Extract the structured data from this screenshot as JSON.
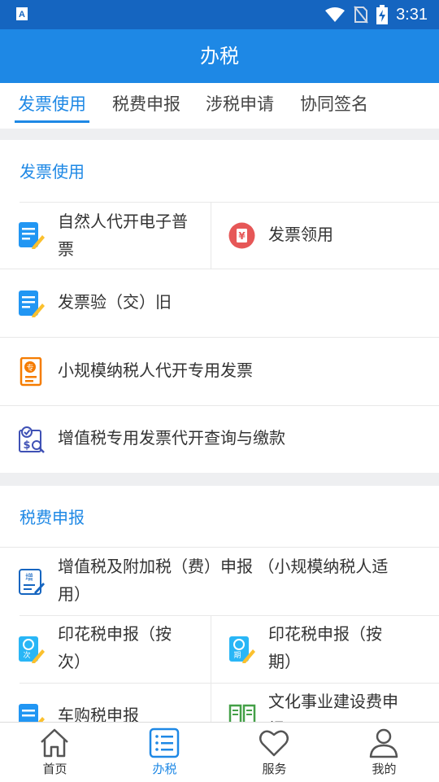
{
  "status_bar": {
    "time": "3:31",
    "app_icon_letter": "A"
  },
  "app_bar": {
    "title": "办税"
  },
  "tabs": [
    {
      "label": "发票使用",
      "active": true
    },
    {
      "label": "税费申报",
      "active": false
    },
    {
      "label": "涉税申请",
      "active": false
    },
    {
      "label": "协同签名",
      "active": false
    }
  ],
  "sections": {
    "invoice": {
      "title": "发票使用",
      "items": [
        {
          "label_line1": "自然人代开电子普",
          "label_line2": "票",
          "icon": "edit-document-icon"
        },
        {
          "label": "发票领用",
          "icon": "yuan-circle-icon"
        },
        {
          "label": "发票验（交）旧",
          "icon": "edit-document-icon"
        },
        {
          "label": "小规模纳税人代开专用发票",
          "icon": "special-invoice-icon"
        },
        {
          "label": "增值税专用发票代开查询与缴款",
          "icon": "payment-query-icon"
        }
      ]
    },
    "declare": {
      "title": "税费申报",
      "items": [
        {
          "label_line1": "增值税及附加税（费）申报 （小规模纳税人适",
          "label_line2": "用）",
          "icon": "vat-declare-icon"
        },
        {
          "label_line1": "印花税申报（按",
          "label_line2": "次）",
          "icon": "stamp-tax-per-time-icon",
          "badge": "次"
        },
        {
          "label_line1": "印花税申报（按",
          "label_line2": "期）",
          "icon": "stamp-tax-per-period-icon",
          "badge": "期"
        },
        {
          "label": "车购税申报",
          "icon": "edit-document-icon"
        },
        {
          "label_line1": "文化事业建设费申",
          "label_line2": "报",
          "icon": "book-icon"
        }
      ]
    }
  },
  "bottom_nav": [
    {
      "label": "首页",
      "icon": "home-icon",
      "active": false
    },
    {
      "label": "办税",
      "icon": "list-icon",
      "active": true
    },
    {
      "label": "服务",
      "icon": "heart-icon",
      "active": false
    },
    {
      "label": "我的",
      "icon": "person-icon",
      "active": false
    }
  ],
  "colors": {
    "primary": "#1e88e5",
    "status_bar": "#1565c0",
    "divider_gap": "#eeeff1"
  }
}
